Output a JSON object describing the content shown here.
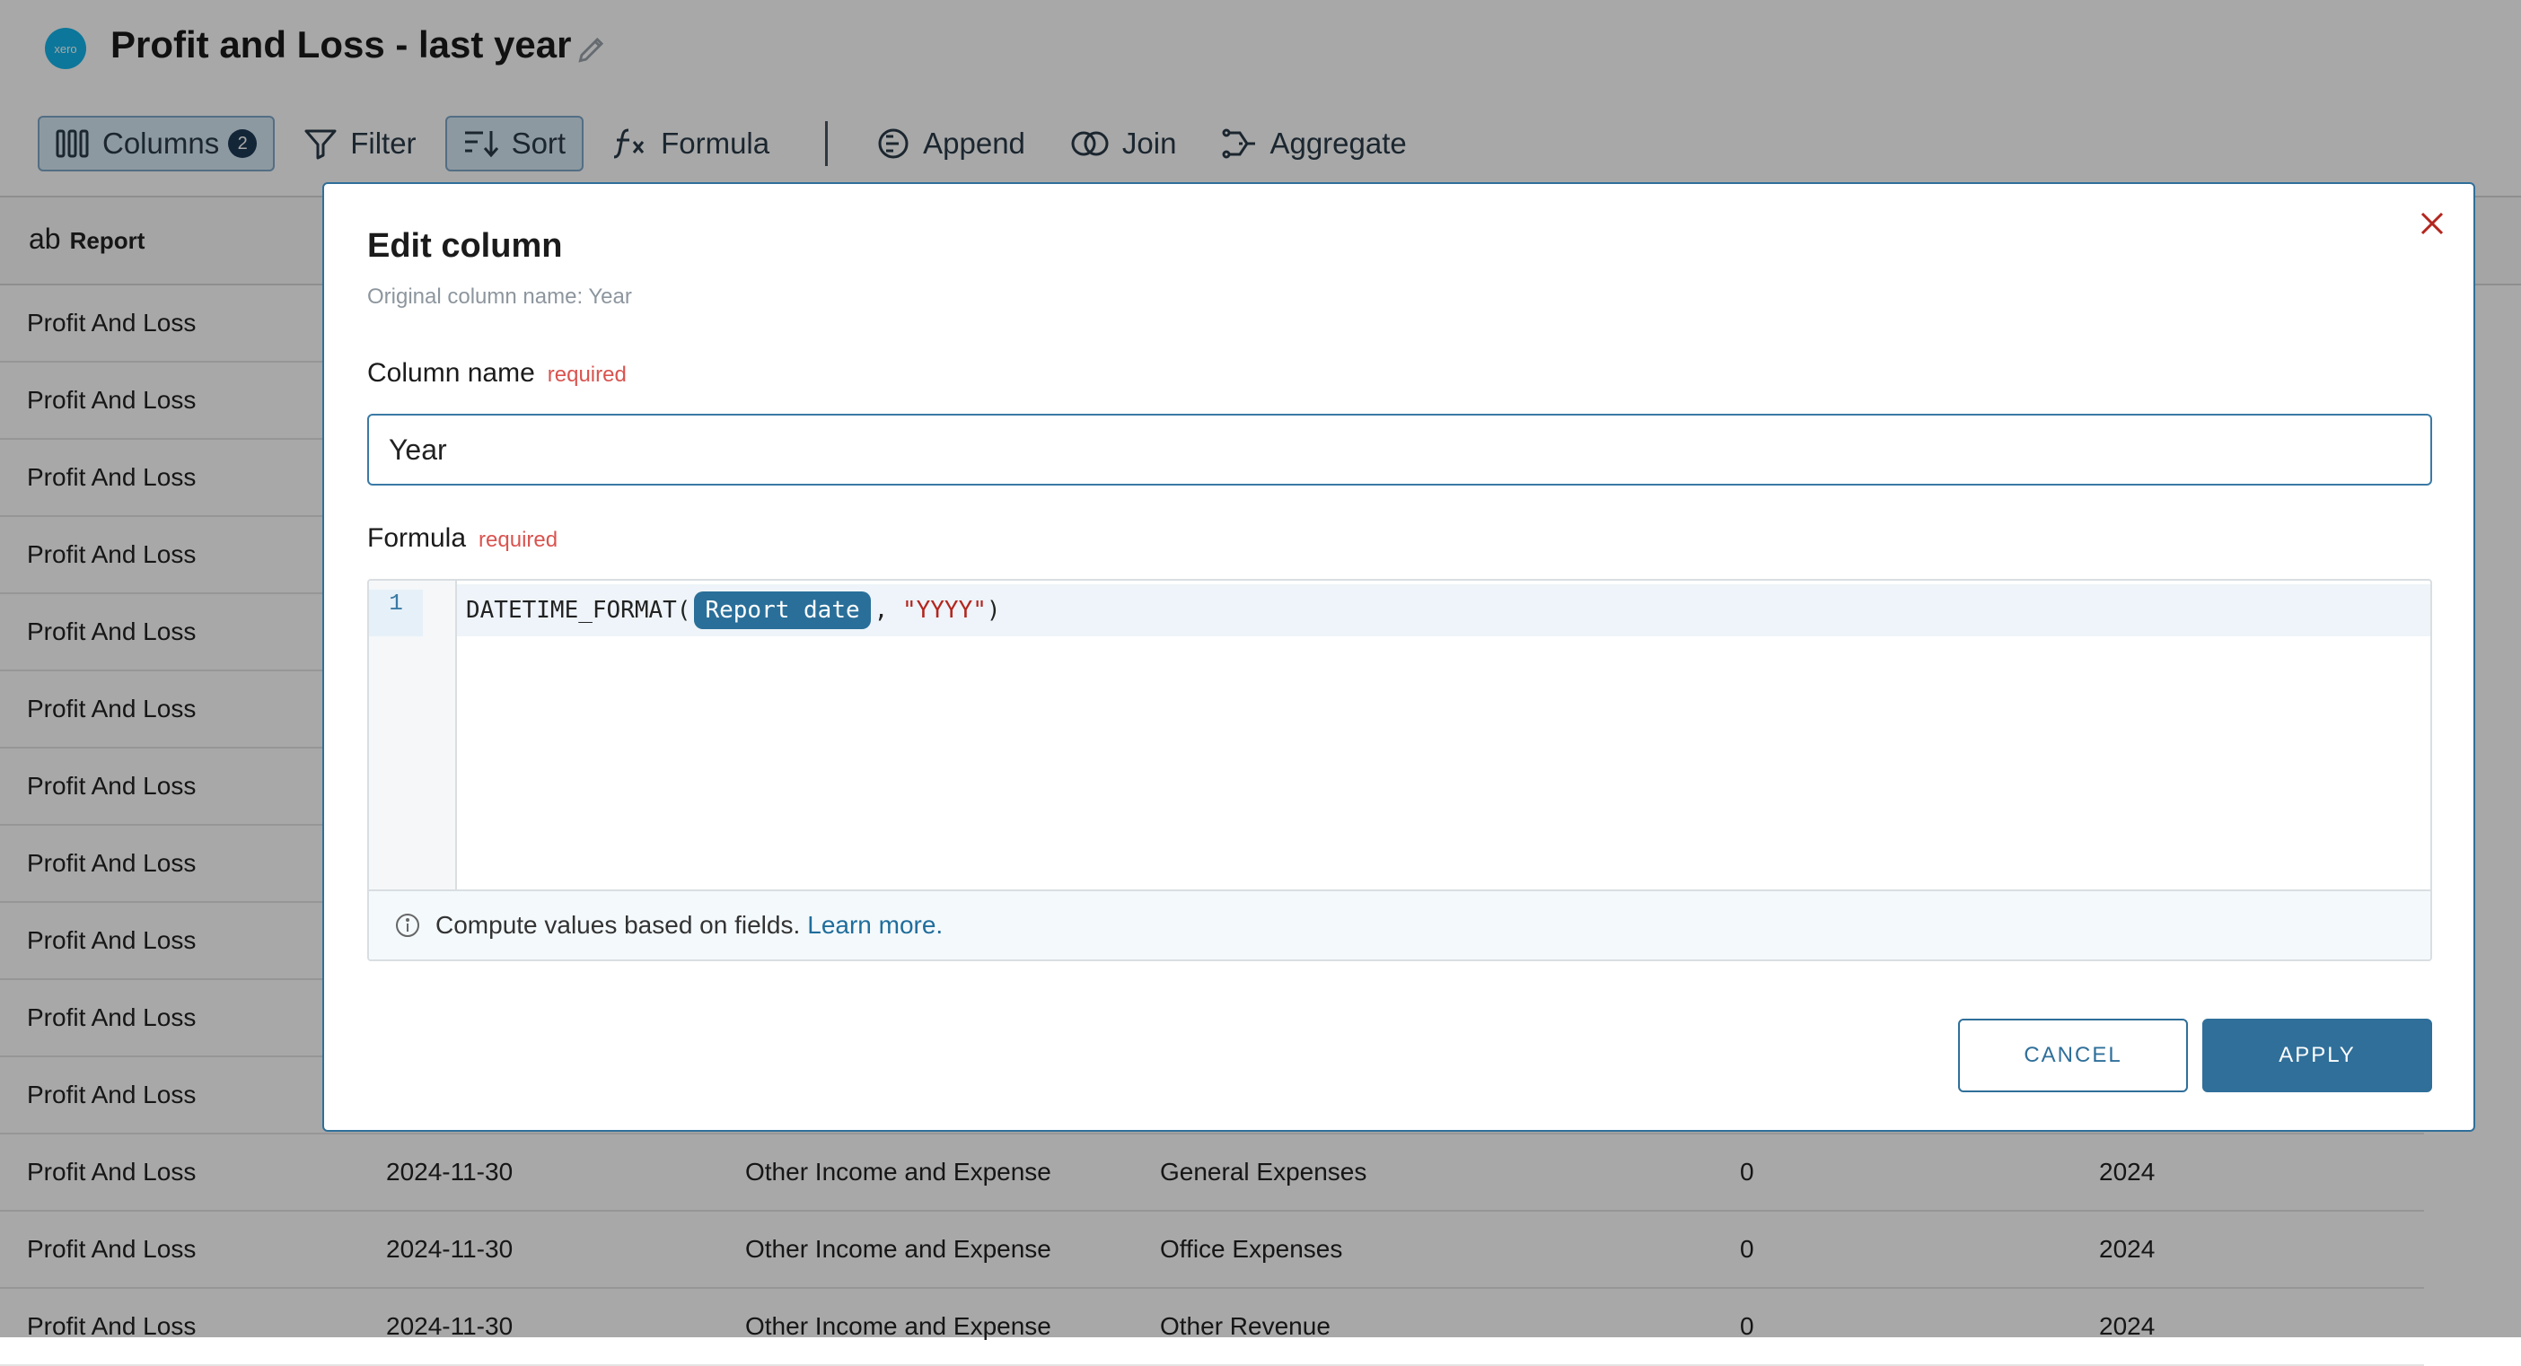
{
  "header": {
    "logo_text": "xero",
    "title": "Profit and Loss - last year"
  },
  "toolbar": {
    "columns_label": "Columns",
    "columns_count": "2",
    "filter_label": "Filter",
    "sort_label": "Sort",
    "formula_label": "Formula",
    "append_label": "Append",
    "join_label": "Join",
    "aggregate_label": "Aggregate"
  },
  "table": {
    "type_prefix": "ab",
    "header_report": "Report",
    "rows": [
      [
        "Profit And Loss",
        "",
        "",
        "",
        "",
        ""
      ],
      [
        "Profit And Loss",
        "",
        "",
        "",
        "",
        ""
      ],
      [
        "Profit And Loss",
        "",
        "",
        "",
        "",
        ""
      ],
      [
        "Profit And Loss",
        "",
        "",
        "",
        "",
        ""
      ],
      [
        "Profit And Loss",
        "",
        "",
        "",
        "",
        ""
      ],
      [
        "Profit And Loss",
        "",
        "",
        "",
        "",
        ""
      ],
      [
        "Profit And Loss",
        "",
        "",
        "",
        "",
        ""
      ],
      [
        "Profit And Loss",
        "",
        "",
        "",
        "",
        ""
      ],
      [
        "Profit And Loss",
        "",
        "",
        "",
        "",
        ""
      ],
      [
        "Profit And Loss",
        "",
        "",
        "",
        "",
        ""
      ],
      [
        "Profit And Loss",
        "",
        "",
        "",
        "",
        ""
      ],
      [
        "Profit And Loss",
        "2024-11-30",
        "Other Income and Expense",
        "General Expenses",
        "0",
        "2024"
      ],
      [
        "Profit And Loss",
        "2024-11-30",
        "Other Income and Expense",
        "Office Expenses",
        "0",
        "2024"
      ],
      [
        "Profit And Loss",
        "2024-11-30",
        "Other Income and Expense",
        "Other Revenue",
        "0",
        "2024"
      ]
    ]
  },
  "modal": {
    "title": "Edit column",
    "original_name": "Original column name: Year",
    "column_name_label": "Column name",
    "column_name_required": "required",
    "column_name_value": "Year",
    "formula_label": "Formula",
    "formula_required": "required",
    "line_number": "1",
    "formula_fn": "DATETIME_FORMAT(",
    "formula_field": "Report date",
    "formula_sep": ", ",
    "formula_str": "\"YYYY\"",
    "formula_close": ")",
    "hint_text": "Compute values based on fields.",
    "hint_link": "Learn more.",
    "cancel_label": "CANCEL",
    "apply_label": "APPLY"
  },
  "colors": {
    "accent": "#2f6f9a",
    "required": "#d9534f",
    "chip": "#2a6f99"
  }
}
